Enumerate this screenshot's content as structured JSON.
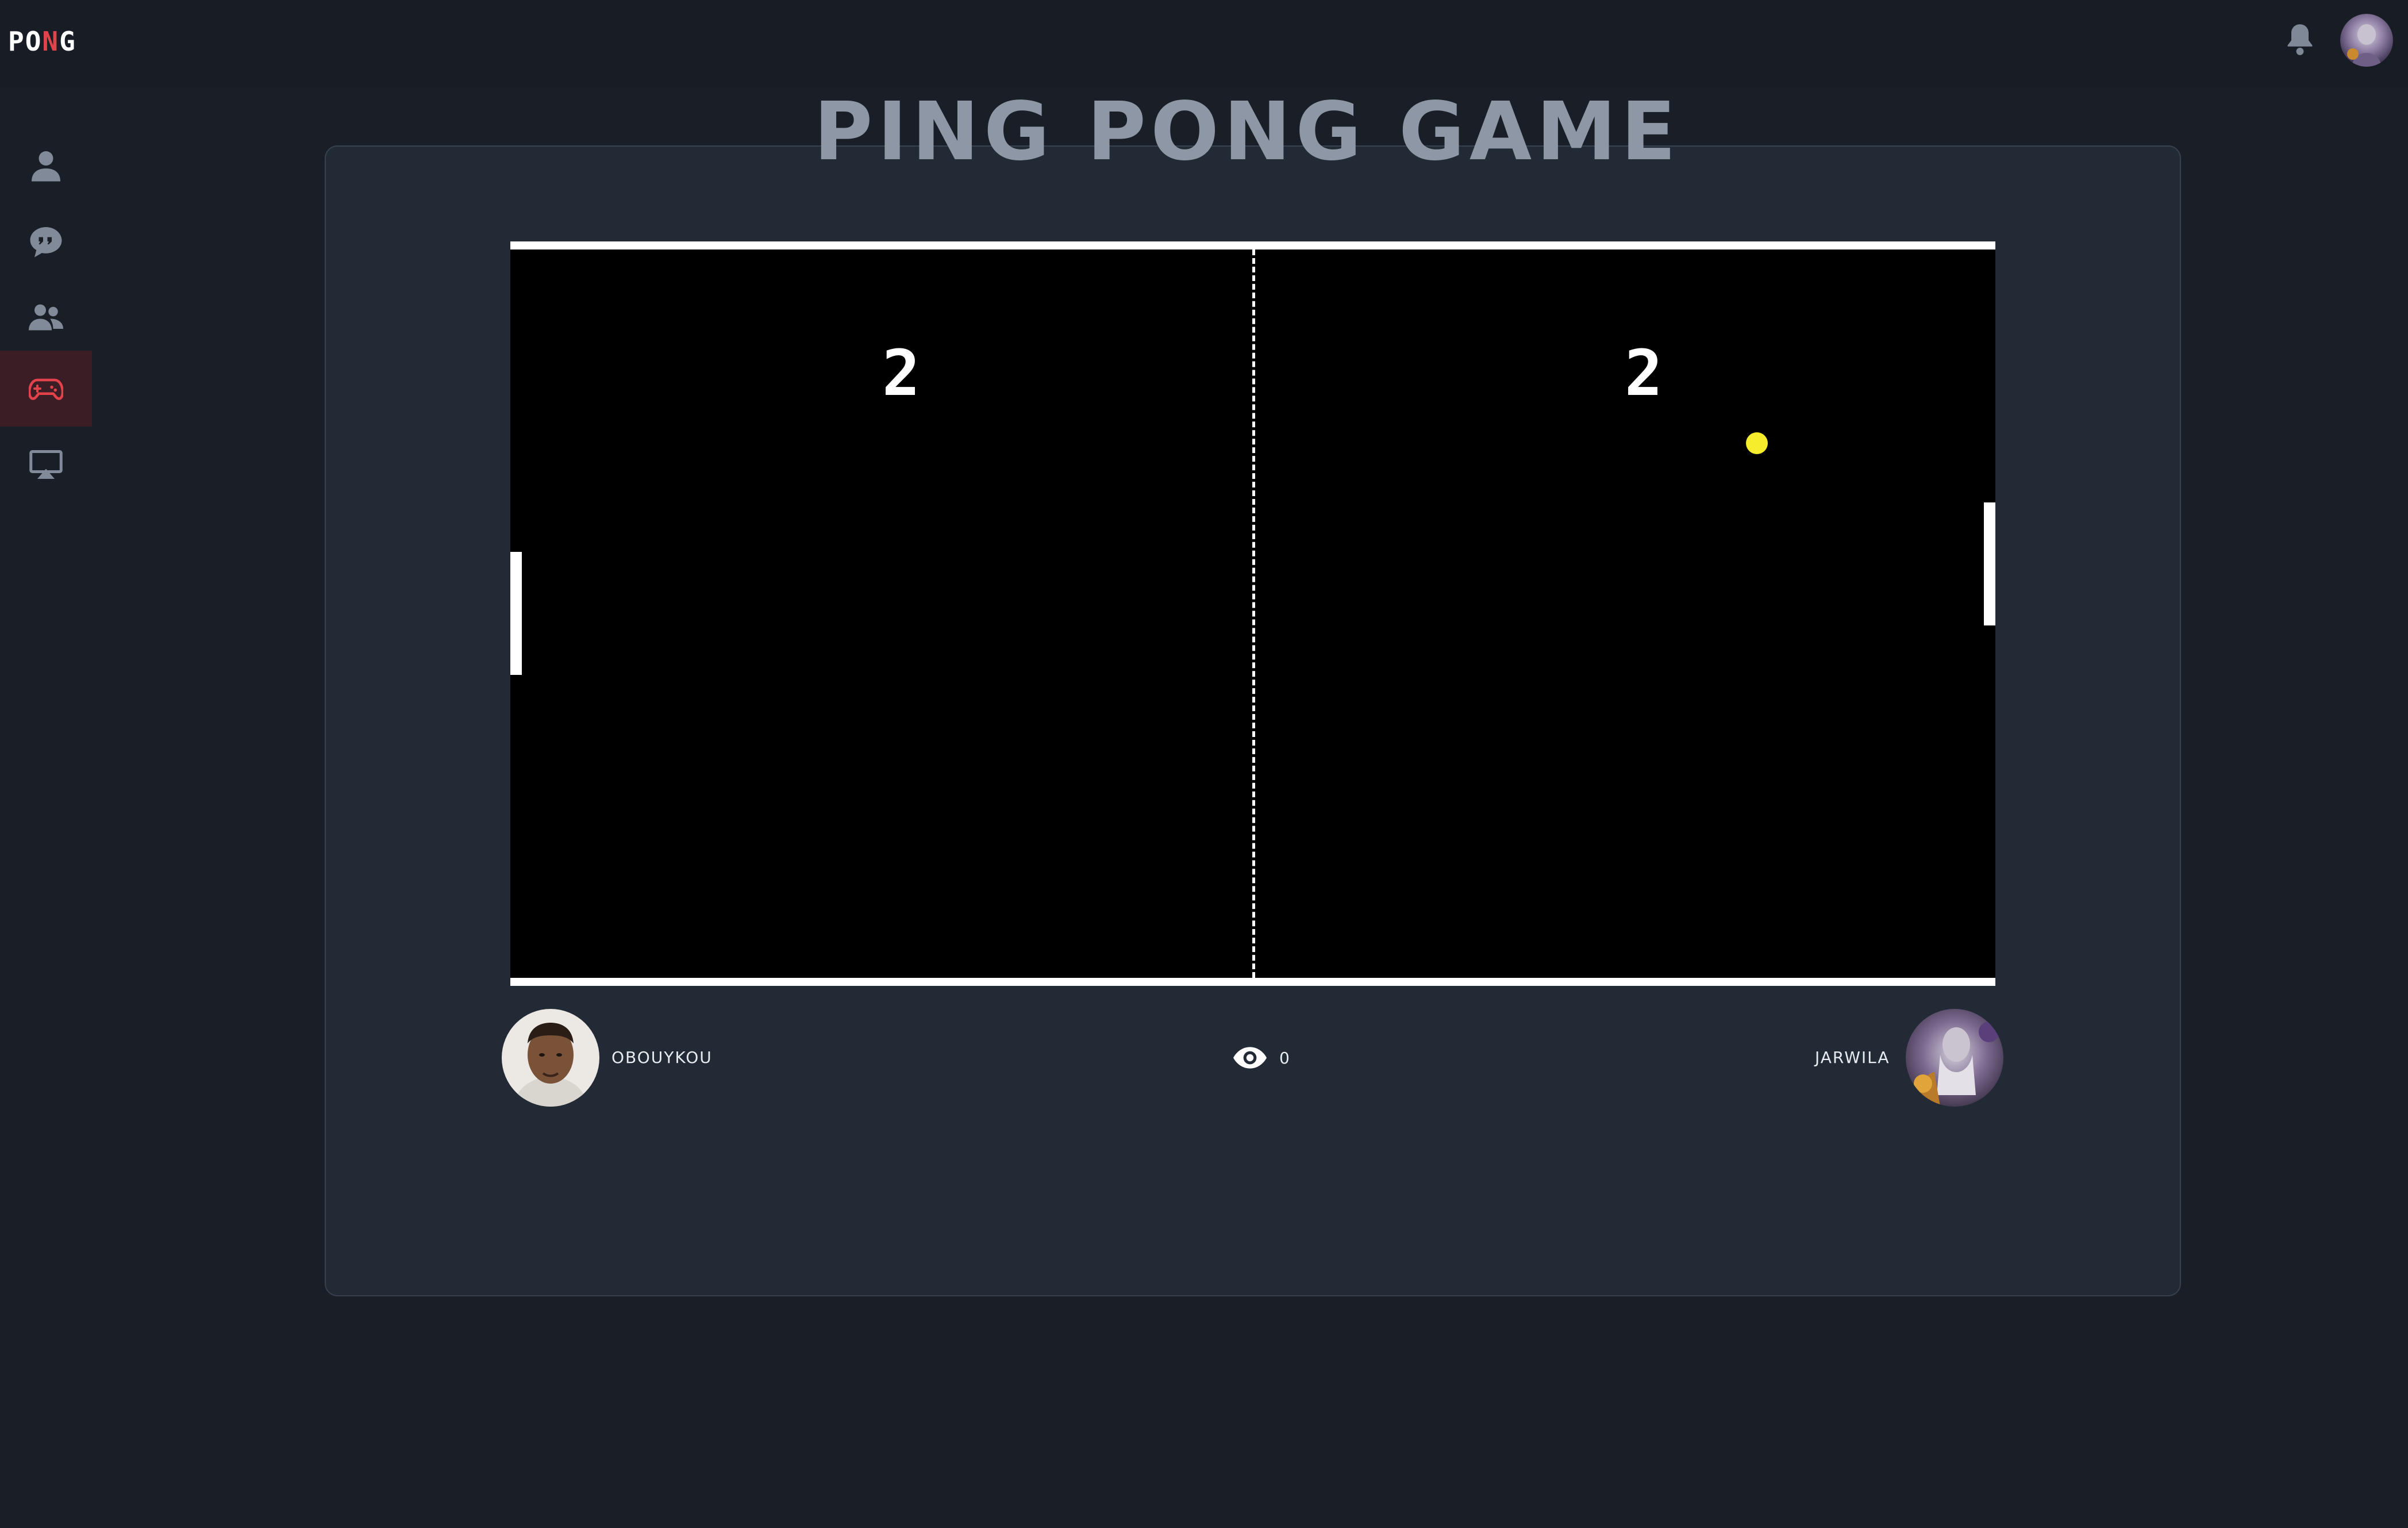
{
  "app": {
    "logo_text_1": "PO",
    "logo_text_accent": "N",
    "logo_text_2": "G"
  },
  "header": {
    "notification_icon": "bell-icon",
    "avatar_icon": "user-avatar"
  },
  "sidebar": {
    "items": [
      {
        "name": "profile",
        "icon": "user-icon",
        "active": false
      },
      {
        "name": "chat",
        "icon": "chat-bubble-icon",
        "active": false
      },
      {
        "name": "friends",
        "icon": "users-icon",
        "active": false
      },
      {
        "name": "game",
        "icon": "gamepad-icon",
        "active": true
      },
      {
        "name": "watch",
        "icon": "airplay-icon",
        "active": false
      }
    ]
  },
  "game": {
    "title": "PING PONG GAME",
    "left_score": "2",
    "right_score": "2",
    "left_player": "OBOUYKOU",
    "right_player": "JARWILA",
    "spectator_count": "0",
    "colors": {
      "ball": "#f6ee2c",
      "accent": "#e2434b",
      "court": "#000000",
      "panel": "#222a35"
    }
  }
}
